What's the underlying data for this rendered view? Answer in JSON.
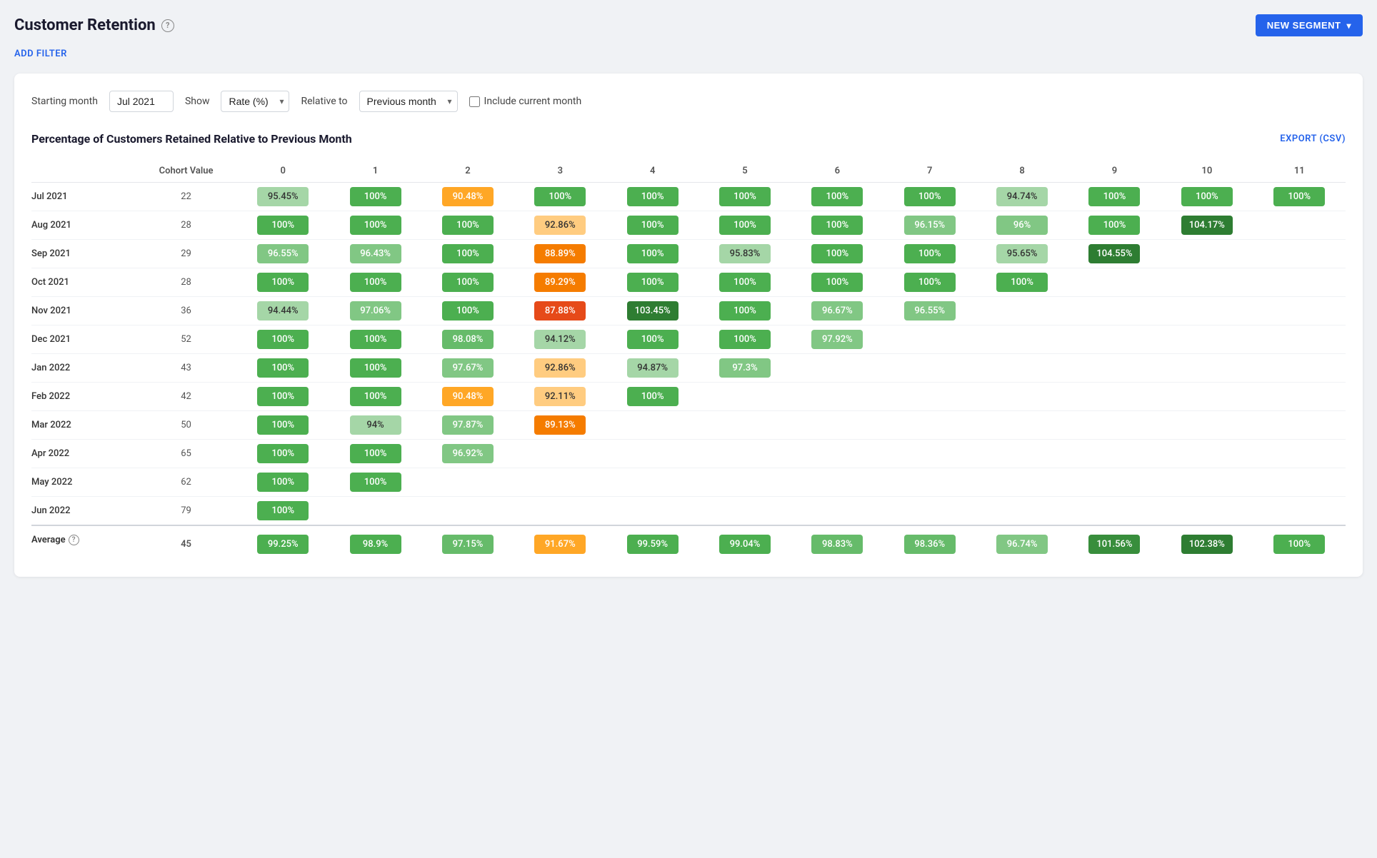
{
  "page": {
    "title": "Customer Retention",
    "add_filter": "ADD FILTER",
    "new_segment_label": "NEW SEGMENT",
    "export_label": "EXPORT (CSV)",
    "chart_title": "Percentage of Customers Retained Relative to Previous Month"
  },
  "controls": {
    "starting_month_label": "Starting month",
    "starting_month_value": "Jul 2021",
    "show_label": "Show",
    "show_value": "Rate (%)",
    "relative_to_label": "Relative to",
    "relative_to_value": "Previous month",
    "include_current_label": "Include current month"
  },
  "table": {
    "columns": [
      "Cohort Value",
      "0",
      "1",
      "2",
      "3",
      "4",
      "5",
      "6",
      "7",
      "8",
      "9",
      "10",
      "11"
    ],
    "rows": [
      {
        "label": "Jul 2021",
        "value": "22",
        "cells": [
          "95.45%",
          "100%",
          "90.48%",
          "100%",
          "100%",
          "100%",
          "100%",
          "100%",
          "94.74%",
          "100%",
          "100%",
          "100%"
        ]
      },
      {
        "label": "Aug 2021",
        "value": "28",
        "cells": [
          "100%",
          "100%",
          "100%",
          "92.86%",
          "100%",
          "100%",
          "100%",
          "96.15%",
          "96%",
          "100%",
          "104.17%",
          null
        ]
      },
      {
        "label": "Sep 2021",
        "value": "29",
        "cells": [
          "96.55%",
          "96.43%",
          "100%",
          "88.89%",
          "100%",
          "95.83%",
          "100%",
          "100%",
          "95.65%",
          "104.55%",
          null,
          null
        ]
      },
      {
        "label": "Oct 2021",
        "value": "28",
        "cells": [
          "100%",
          "100%",
          "100%",
          "89.29%",
          "100%",
          "100%",
          "100%",
          "100%",
          "100%",
          null,
          null,
          null
        ]
      },
      {
        "label": "Nov 2021",
        "value": "36",
        "cells": [
          "94.44%",
          "97.06%",
          "100%",
          "87.88%",
          "103.45%",
          "100%",
          "96.67%",
          "96.55%",
          null,
          null,
          null,
          null
        ]
      },
      {
        "label": "Dec 2021",
        "value": "52",
        "cells": [
          "100%",
          "100%",
          "98.08%",
          "94.12%",
          "100%",
          "100%",
          "97.92%",
          null,
          null,
          null,
          null,
          null
        ]
      },
      {
        "label": "Jan 2022",
        "value": "43",
        "cells": [
          "100%",
          "100%",
          "97.67%",
          "92.86%",
          "94.87%",
          "97.3%",
          null,
          null,
          null,
          null,
          null,
          null
        ]
      },
      {
        "label": "Feb 2022",
        "value": "42",
        "cells": [
          "100%",
          "100%",
          "90.48%",
          "92.11%",
          "100%",
          null,
          null,
          null,
          null,
          null,
          null,
          null
        ]
      },
      {
        "label": "Mar 2022",
        "value": "50",
        "cells": [
          "100%",
          "94%",
          "97.87%",
          "89.13%",
          null,
          null,
          null,
          null,
          null,
          null,
          null,
          null
        ]
      },
      {
        "label": "Apr 2022",
        "value": "65",
        "cells": [
          "100%",
          "100%",
          "96.92%",
          null,
          null,
          null,
          null,
          null,
          null,
          null,
          null,
          null
        ]
      },
      {
        "label": "May 2022",
        "value": "62",
        "cells": [
          "100%",
          "100%",
          null,
          null,
          null,
          null,
          null,
          null,
          null,
          null,
          null,
          null
        ]
      },
      {
        "label": "Jun 2022",
        "value": "79",
        "cells": [
          "100%",
          null,
          null,
          null,
          null,
          null,
          null,
          null,
          null,
          null,
          null,
          null
        ]
      }
    ],
    "footer": {
      "label": "Average",
      "value": "45",
      "cells": [
        "99.25%",
        "98.9%",
        "97.15%",
        "91.67%",
        "99.59%",
        "99.04%",
        "98.83%",
        "98.36%",
        "96.74%",
        "101.56%",
        "102.38%",
        "100%"
      ]
    }
  },
  "colors": {
    "dark_green": "#2e7d32",
    "medium_green": "#4caf50",
    "light_green": "#a5d6a7",
    "very_light_green": "#c8e6c9",
    "light_orange": "#ffcc80",
    "medium_orange": "#ff9800",
    "dark_orange": "#e65100",
    "red_orange": "#d32f2f",
    "accent_blue": "#2563eb"
  }
}
